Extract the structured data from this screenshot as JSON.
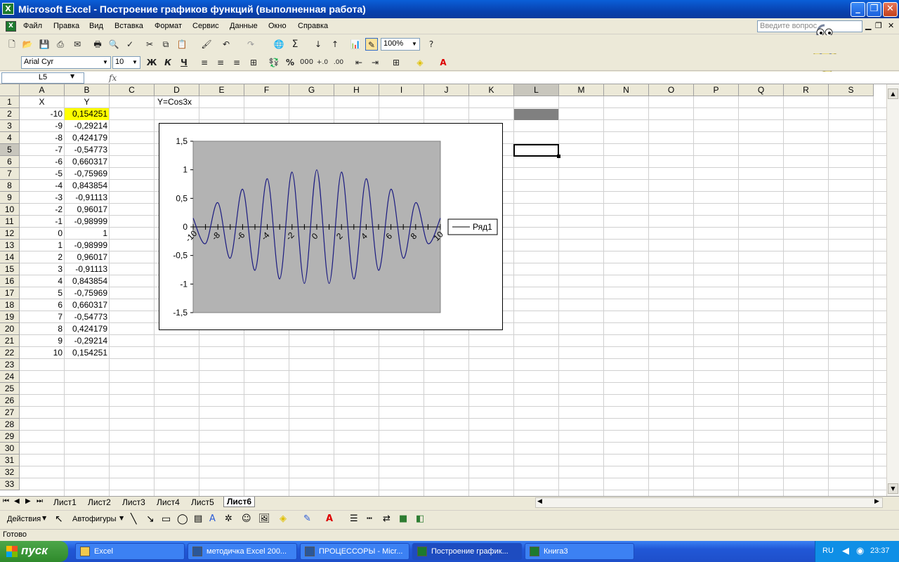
{
  "window": {
    "title": "Microsoft Excel - Построение графиков функций (выполненная работа)"
  },
  "menu": [
    "Файл",
    "Правка",
    "Вид",
    "Вставка",
    "Формат",
    "Сервис",
    "Данные",
    "Окно",
    "Справка"
  ],
  "ask_placeholder": "Введите вопрос",
  "toolbar": {
    "zoom": "100%",
    "font": "Arial Cyr",
    "size": "10",
    "bold": "Ж",
    "italic": "К",
    "underline": "Ч",
    "percent": "%",
    "thousands": "000"
  },
  "formula": {
    "namebox": "L5",
    "fx": "fx",
    "content": ""
  },
  "columns": [
    "A",
    "B",
    "C",
    "D",
    "E",
    "F",
    "G",
    "H",
    "I",
    "J",
    "K",
    "L",
    "M",
    "N",
    "O",
    "P",
    "Q",
    "R",
    "S"
  ],
  "rows": [
    "1",
    "2",
    "3",
    "4",
    "5",
    "6",
    "7",
    "8",
    "9",
    "10",
    "11",
    "12",
    "13",
    "14",
    "15",
    "16",
    "17",
    "18",
    "19",
    "20",
    "21",
    "22",
    "23",
    "24",
    "25",
    "26",
    "27",
    "28",
    "29",
    "30",
    "31",
    "32",
    "33"
  ],
  "sheet": {
    "header_x": "X",
    "header_y": "Y",
    "label_d1": "Y=Cos3x",
    "x_values": [
      "-10",
      "-9",
      "-8",
      "-7",
      "-6",
      "-5",
      "-4",
      "-3",
      "-2",
      "-1",
      "0",
      "1",
      "2",
      "3",
      "4",
      "5",
      "6",
      "7",
      "8",
      "9",
      "10"
    ],
    "y_values": [
      "0,154251",
      "-0,29214",
      "0,424179",
      "-0,54773",
      "0,660317",
      "-0,75969",
      "0,843854",
      "-0,91113",
      "0,96017",
      "-0,98999",
      "1",
      "-0,98999",
      "0,96017",
      "-0,91113",
      "0,843854",
      "-0,75969",
      "0,660317",
      "-0,54773",
      "0,424179",
      "-0,29214",
      "0,154251"
    ]
  },
  "chart_data": {
    "type": "line",
    "title": "",
    "function": "y=cos(3x)",
    "x": [
      -10,
      -9,
      -8,
      -7,
      -6,
      -5,
      -4,
      -3,
      -2,
      -1,
      0,
      1,
      2,
      3,
      4,
      5,
      6,
      7,
      8,
      9,
      10
    ],
    "series": [
      {
        "name": "Ряд1",
        "values": [
          0.154251,
          -0.29214,
          0.424179,
          -0.54773,
          0.660317,
          -0.75969,
          0.843854,
          -0.91113,
          0.96017,
          -0.98999,
          1,
          -0.98999,
          0.96017,
          -0.91113,
          0.843854,
          -0.75969,
          0.660317,
          -0.54773,
          0.424179,
          -0.29214,
          0.154251
        ]
      }
    ],
    "ylim": [
      -1.5,
      1.5
    ],
    "y_ticks": [
      "1,5",
      "1",
      "0,5",
      "0",
      "-0,5",
      "-1",
      "-1,5"
    ],
    "x_tick_labels": [
      "-10",
      "-8",
      "-6",
      "-4",
      "-2",
      "0",
      "2",
      "4",
      "6",
      "8",
      "10"
    ],
    "legend_position": "right",
    "plot_background": "#b3b3b3",
    "line_color": "#1a1a80"
  },
  "tabs": [
    "Лист1",
    "Лист2",
    "Лист3",
    "Лист4",
    "Лист5",
    "Лист6"
  ],
  "active_tab": "Лист6",
  "drawbar": {
    "actions": "Действия",
    "autoshapes": "Автофигуры"
  },
  "status": "Готово",
  "taskbar": {
    "start": "пуск",
    "tasks": [
      "Excel",
      "методичка Excel 200...",
      "ПРОЦЕССОРЫ - Micr...",
      "Построение график...",
      "Книга3"
    ],
    "lang": "RU",
    "clock": "23:37"
  },
  "colors": {
    "selected_cell": "#ffff00",
    "l2_fill": "#808080",
    "title_bar": "#0842b0"
  }
}
